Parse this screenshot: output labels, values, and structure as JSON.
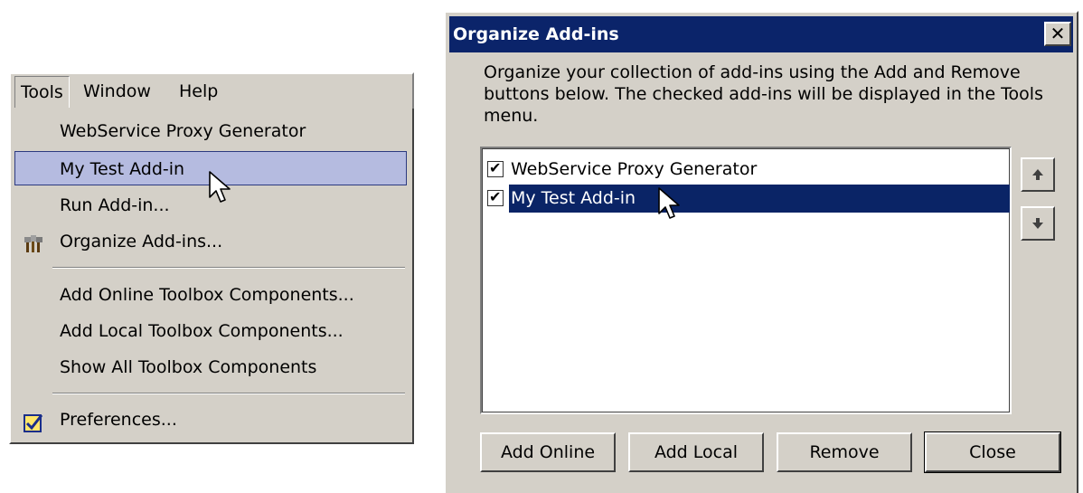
{
  "menu": {
    "menubar": [
      "Tools",
      "Window",
      "Help"
    ],
    "items": [
      {
        "label": "WebService Proxy Generator",
        "icon": null
      },
      {
        "label": "My Test Add-in",
        "icon": null,
        "highlighted": true
      },
      {
        "label": "Run Add-in...",
        "icon": null
      },
      {
        "label": "Organize Add-ins...",
        "icon": "tools-icon"
      },
      {
        "label": "Add Online Toolbox Components...",
        "icon": null
      },
      {
        "label": "Add Local Toolbox Components...",
        "icon": null
      },
      {
        "label": "Show All Toolbox Components",
        "icon": null
      },
      {
        "label": "Preferences...",
        "icon": "checkbox-icon"
      }
    ]
  },
  "dialog": {
    "title": "Organize Add-ins",
    "description": "Organize your collection of add-ins using the Add and Remove buttons below. The checked add-ins will be displayed in the Tools menu.",
    "addins": [
      {
        "label": "WebService Proxy Generator",
        "checked": true
      },
      {
        "label": "My Test Add-in",
        "checked": true,
        "selected": true
      }
    ],
    "buttons": {
      "add_online": "Add Online",
      "add_local": "Add Local",
      "remove": "Remove",
      "close": "Close"
    }
  },
  "colors": {
    "face": "#d4d0c8",
    "titlebar": "#0b246a",
    "menu_highlight": "#b5bbe0",
    "list_selection": "#0a2466"
  }
}
